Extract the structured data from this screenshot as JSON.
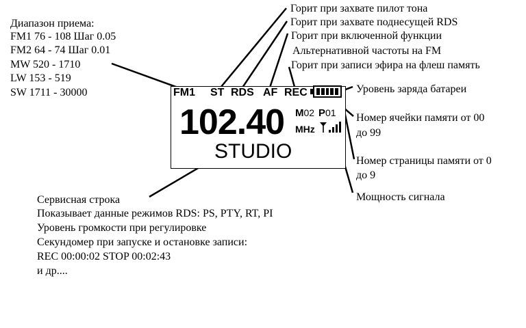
{
  "range": {
    "title": "Диапазон приема:",
    "items": [
      "FM1 76 - 108 Шаг 0.05",
      "FM2 64 - 74 Шаг 0.01",
      "MW 520 - 1710",
      "LW 153 - 519",
      "SW 1711 - 30000"
    ]
  },
  "display": {
    "indicators": [
      "FM1",
      "ST",
      "RDS",
      "AF",
      "REC"
    ],
    "frequency": "102.40",
    "unit": "MHz",
    "station": "STUDIO",
    "memory_cell_prefix": "M",
    "memory_cell_value": "02",
    "memory_page_prefix": "P",
    "memory_page_value": "01",
    "battery_level_bars": 5,
    "signal_level_bars": 4
  },
  "callouts": {
    "pilot": "Горит при захвате пилот тона",
    "rds": "Горит при захвате поднесущей RDS",
    "af_line1": "Горит при включенной функции",
    "af_line2": "Альтернативной частоты на FM",
    "rec": "Горит при записи эфира на флеш память",
    "battery": "Уровень заряда батареи",
    "cell_line1": "Номер ячейки памяти от 00",
    "cell_line2": "до 99",
    "page_line1": "Номер страницы памяти от 0",
    "page_line2": "до 9",
    "signal": "Мощность сигнала"
  },
  "service": {
    "lines": [
      "Сервисная строка",
      "Показывает данные режимов RDS: PS, PTY, RT, PI",
      "Уровень громкости при регулировке",
      "Секундомер при запуске и остановке записи:",
      "REC 00:00:02  STOP 00:02:43",
      "и др...."
    ]
  }
}
